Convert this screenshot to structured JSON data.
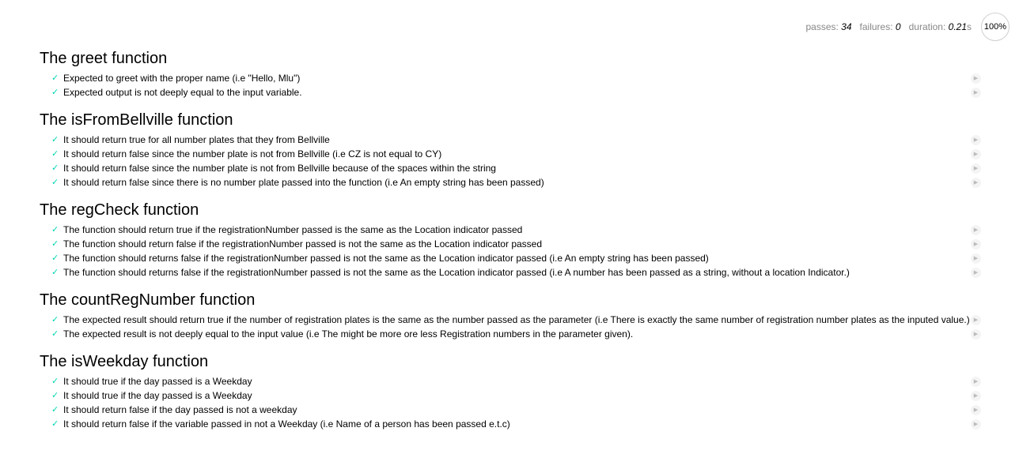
{
  "stats": {
    "passes_label": "passes:",
    "passes": "34",
    "failures_label": "failures:",
    "failures": "0",
    "duration_label": "duration:",
    "duration": "0.21",
    "duration_unit": "s",
    "progress": "100%"
  },
  "icons": {
    "pass": "check-icon",
    "replay": "replay-icon"
  },
  "colors": {
    "pass": "#00d6b2",
    "muted": "#888888"
  },
  "suites": [
    {
      "title": "The greet function",
      "tests": [
        "Expected to greet with the proper name (i.e \"Hello, Mlu\")",
        "Expected output is not deeply equal to the input variable."
      ]
    },
    {
      "title": "The isFromBellville function",
      "tests": [
        "It should return true for all number plates that they from Bellville",
        "It should return false since the number plate is not from Bellville (i.e CZ is not equal to CY)",
        "It should return false since the number plate is not from Bellville because of the spaces within the string",
        "It should return false since there is no number plate passed into the function (i.e An empty string has been passed)"
      ]
    },
    {
      "title": "The regCheck function",
      "tests": [
        "The function should return true if the registrationNumber passed is the same as the Location indicator passed",
        "The function should return false if the registrationNumber passed is not the same as the Location indicator passed",
        "The function should returns false if the registrationNumber passed is not the same as the Location indicator passed (i.e An empty string has been passed)",
        "The function should returns false if the registrationNumber passed is not the same as the Location indicator passed (i.e A number has been passed as a string, without a location Indicator.)"
      ]
    },
    {
      "title": "The countRegNumber function",
      "tests": [
        "The expected result should return true if the number of registration plates is the same as the number passed as the parameter (i.e There is exactly the same number of registration number plates as the inputed value.)",
        "The expected result is not deeply equal to the input value (i.e The might be more ore less Registration numbers in the parameter given)."
      ]
    },
    {
      "title": "The isWeekday function",
      "tests": [
        "It should true if the day passed is a Weekday",
        "It should true if the day passed is a Weekday",
        "It should return false if the day passed is not a weekday",
        "It should return false if the variable passed in not a Weekday (i.e Name of a person has been passed e.t.c)"
      ]
    }
  ]
}
